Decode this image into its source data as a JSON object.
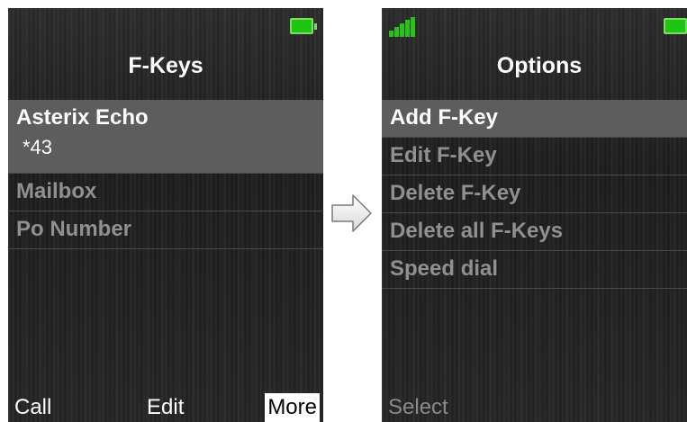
{
  "left_screen": {
    "title": "F-Keys",
    "items": [
      {
        "label": "Asterix Echo",
        "sub": "*43",
        "selected": true
      },
      {
        "label": "Mailbox"
      },
      {
        "label": "Po Number"
      }
    ],
    "softkeys": {
      "left": "Call",
      "center": "Edit",
      "right": "More"
    }
  },
  "right_screen": {
    "title": "Options",
    "items": [
      {
        "label": "Add F-Key",
        "selected": true
      },
      {
        "label": "Edit F-Key"
      },
      {
        "label": "Delete F-Key"
      },
      {
        "label": "Delete all F-Keys"
      },
      {
        "label": "Speed dial"
      }
    ],
    "softkeys": {
      "left": "Select"
    }
  },
  "icons": {
    "battery": "battery-full-icon",
    "signal": "signal-strength-icon",
    "arrow": "right-arrow-icon"
  },
  "colors": {
    "battery_green": "#22c414",
    "signal_green": "#27c21a",
    "selected_row": "#5d5d5d"
  }
}
